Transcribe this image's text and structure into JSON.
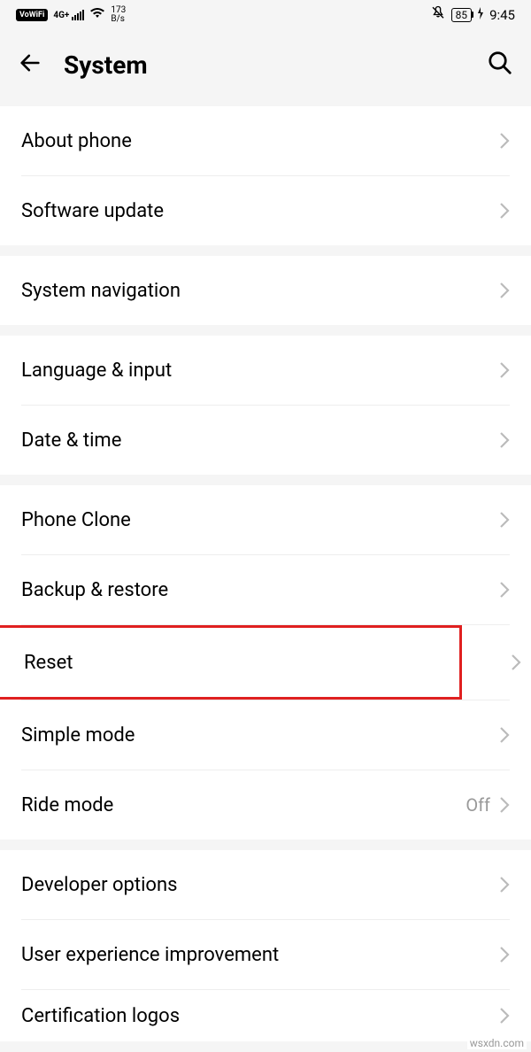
{
  "status_bar": {
    "vowifi": "VoWiFi",
    "network": "4G+",
    "speed_value": "173",
    "speed_unit": "B/s",
    "battery": "85",
    "time": "9:45"
  },
  "header": {
    "title": "System"
  },
  "sections": [
    {
      "items": [
        {
          "key": "about-phone",
          "label": "About phone"
        },
        {
          "key": "software-update",
          "label": "Software update"
        }
      ]
    },
    {
      "items": [
        {
          "key": "system-navigation",
          "label": "System navigation"
        }
      ]
    },
    {
      "items": [
        {
          "key": "language-input",
          "label": "Language & input"
        },
        {
          "key": "date-time",
          "label": "Date & time"
        }
      ]
    },
    {
      "items": [
        {
          "key": "phone-clone",
          "label": "Phone Clone"
        },
        {
          "key": "backup-restore",
          "label": "Backup & restore"
        },
        {
          "key": "reset",
          "label": "Reset",
          "highlighted": true
        },
        {
          "key": "simple-mode",
          "label": "Simple mode"
        },
        {
          "key": "ride-mode",
          "label": "Ride mode",
          "value": "Off"
        }
      ]
    },
    {
      "items": [
        {
          "key": "developer-options",
          "label": "Developer options"
        },
        {
          "key": "user-experience",
          "label": "User experience improvement"
        },
        {
          "key": "certification-logos",
          "label": "Certification logos"
        }
      ]
    }
  ],
  "watermark": "wsxdn.com"
}
